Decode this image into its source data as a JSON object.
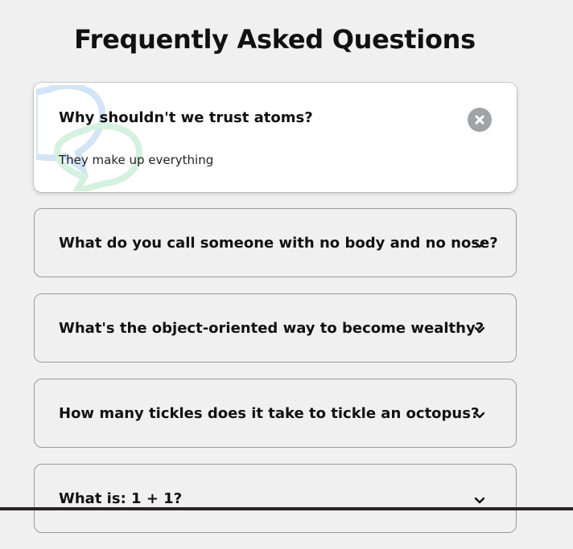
{
  "page": {
    "title": "Frequently Asked Questions"
  },
  "faqs": [
    {
      "question": "Why shouldn't we trust atoms?",
      "answer": "They make up everything",
      "expanded": true,
      "toggle_icon": "close-icon"
    },
    {
      "question": "What do you call someone with no body and no nose?",
      "expanded": false,
      "toggle_icon": "chevron-down-icon"
    },
    {
      "question": "What's the object-oriented way to become wealthy?",
      "expanded": false,
      "toggle_icon": "chevron-down-icon"
    },
    {
      "question": "How many tickles does it take to tickle an octopus?",
      "expanded": false,
      "toggle_icon": "chevron-down-icon"
    },
    {
      "question": "What is: 1 + 1?",
      "expanded": false,
      "toggle_icon": "chevron-down-icon"
    }
  ],
  "colors": {
    "background": "#f0f0f0",
    "card_active": "#ffffff",
    "card_border": "#9b9b9b",
    "close_button": "#9fa4a8",
    "bubble_blue": "#d2e4f5",
    "bubble_green": "#d5f1df",
    "footer_bar": "#2a2225"
  }
}
